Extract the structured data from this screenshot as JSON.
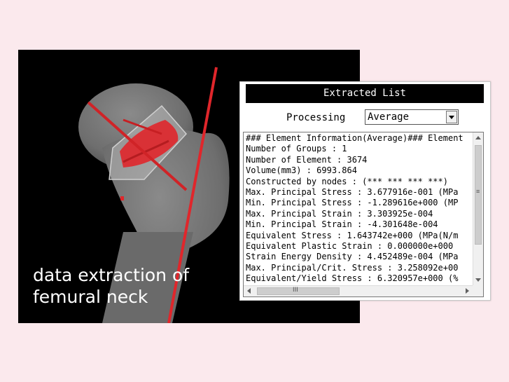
{
  "caption": {
    "line1": "data extraction of",
    "line2": "femural neck"
  },
  "panel": {
    "title": "Extracted List",
    "processing_label": "Processing",
    "processing_value": "Average",
    "lines": [
      "### Element Information(Average)### Element",
      "Number of Groups : 1",
      "Number of Element : 3674",
      "Volume(mm3) : 6993.864",
      "Constructed by nodes : (*** *** *** ***)",
      "Max. Principal Stress : 3.677916e-001 (MPa",
      "Min. Principal Stress : -1.289616e+000 (MP",
      "Max. Principal Strain : 3.303925e-004",
      "Min. Principal Strain : -4.301648e-004",
      "Equivalent Stress : 1.643742e+000 (MPa(N/m",
      "Equivalent Plastic Strain : 0.000000e+000",
      "Strain Energy Density : 4.452489e-004 (MPa",
      "Max. Principal/Crit. Stress : 3.258092e+00",
      "Equivalent/Yield Stress : 6.320957e+000 (%"
    ]
  },
  "colors": {
    "background": "#fbe9ed",
    "bone": "#7a7a7a",
    "highlight_red": "#e0262b"
  },
  "icons": {
    "scroll_grip": "≡",
    "hscroll_grip": "III"
  }
}
